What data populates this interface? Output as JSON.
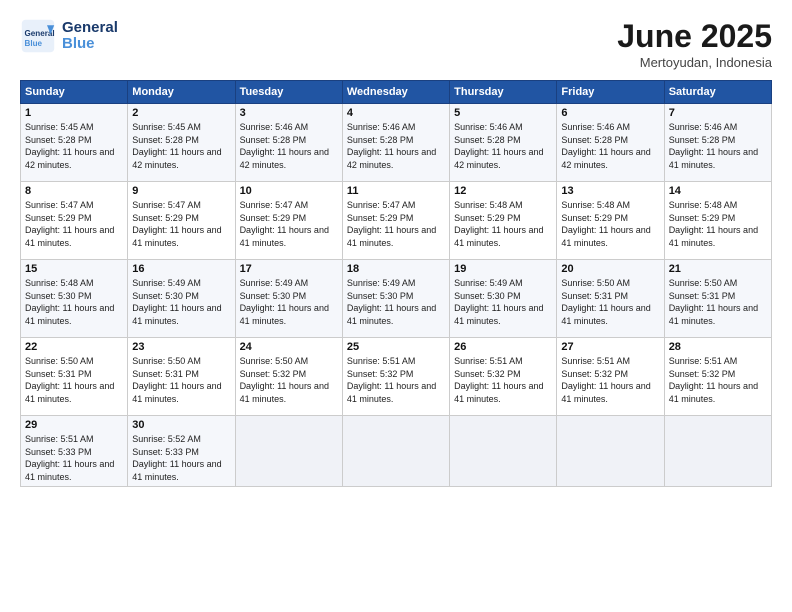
{
  "header": {
    "logo_line1": "General",
    "logo_line2": "Blue",
    "month": "June 2025",
    "location": "Mertoyudan, Indonesia"
  },
  "days_of_week": [
    "Sunday",
    "Monday",
    "Tuesday",
    "Wednesday",
    "Thursday",
    "Friday",
    "Saturday"
  ],
  "weeks": [
    [
      {
        "day": "1",
        "sunrise": "5:45 AM",
        "sunset": "5:28 PM",
        "daylight": "11 hours and 42 minutes."
      },
      {
        "day": "2",
        "sunrise": "5:45 AM",
        "sunset": "5:28 PM",
        "daylight": "11 hours and 42 minutes."
      },
      {
        "day": "3",
        "sunrise": "5:46 AM",
        "sunset": "5:28 PM",
        "daylight": "11 hours and 42 minutes."
      },
      {
        "day": "4",
        "sunrise": "5:46 AM",
        "sunset": "5:28 PM",
        "daylight": "11 hours and 42 minutes."
      },
      {
        "day": "5",
        "sunrise": "5:46 AM",
        "sunset": "5:28 PM",
        "daylight": "11 hours and 42 minutes."
      },
      {
        "day": "6",
        "sunrise": "5:46 AM",
        "sunset": "5:28 PM",
        "daylight": "11 hours and 42 minutes."
      },
      {
        "day": "7",
        "sunrise": "5:46 AM",
        "sunset": "5:28 PM",
        "daylight": "11 hours and 41 minutes."
      }
    ],
    [
      {
        "day": "8",
        "sunrise": "5:47 AM",
        "sunset": "5:29 PM",
        "daylight": "11 hours and 41 minutes."
      },
      {
        "day": "9",
        "sunrise": "5:47 AM",
        "sunset": "5:29 PM",
        "daylight": "11 hours and 41 minutes."
      },
      {
        "day": "10",
        "sunrise": "5:47 AM",
        "sunset": "5:29 PM",
        "daylight": "11 hours and 41 minutes."
      },
      {
        "day": "11",
        "sunrise": "5:47 AM",
        "sunset": "5:29 PM",
        "daylight": "11 hours and 41 minutes."
      },
      {
        "day": "12",
        "sunrise": "5:48 AM",
        "sunset": "5:29 PM",
        "daylight": "11 hours and 41 minutes."
      },
      {
        "day": "13",
        "sunrise": "5:48 AM",
        "sunset": "5:29 PM",
        "daylight": "11 hours and 41 minutes."
      },
      {
        "day": "14",
        "sunrise": "5:48 AM",
        "sunset": "5:29 PM",
        "daylight": "11 hours and 41 minutes."
      }
    ],
    [
      {
        "day": "15",
        "sunrise": "5:48 AM",
        "sunset": "5:30 PM",
        "daylight": "11 hours and 41 minutes."
      },
      {
        "day": "16",
        "sunrise": "5:49 AM",
        "sunset": "5:30 PM",
        "daylight": "11 hours and 41 minutes."
      },
      {
        "day": "17",
        "sunrise": "5:49 AM",
        "sunset": "5:30 PM",
        "daylight": "11 hours and 41 minutes."
      },
      {
        "day": "18",
        "sunrise": "5:49 AM",
        "sunset": "5:30 PM",
        "daylight": "11 hours and 41 minutes."
      },
      {
        "day": "19",
        "sunrise": "5:49 AM",
        "sunset": "5:30 PM",
        "daylight": "11 hours and 41 minutes."
      },
      {
        "day": "20",
        "sunrise": "5:50 AM",
        "sunset": "5:31 PM",
        "daylight": "11 hours and 41 minutes."
      },
      {
        "day": "21",
        "sunrise": "5:50 AM",
        "sunset": "5:31 PM",
        "daylight": "11 hours and 41 minutes."
      }
    ],
    [
      {
        "day": "22",
        "sunrise": "5:50 AM",
        "sunset": "5:31 PM",
        "daylight": "11 hours and 41 minutes."
      },
      {
        "day": "23",
        "sunrise": "5:50 AM",
        "sunset": "5:31 PM",
        "daylight": "11 hours and 41 minutes."
      },
      {
        "day": "24",
        "sunrise": "5:50 AM",
        "sunset": "5:32 PM",
        "daylight": "11 hours and 41 minutes."
      },
      {
        "day": "25",
        "sunrise": "5:51 AM",
        "sunset": "5:32 PM",
        "daylight": "11 hours and 41 minutes."
      },
      {
        "day": "26",
        "sunrise": "5:51 AM",
        "sunset": "5:32 PM",
        "daylight": "11 hours and 41 minutes."
      },
      {
        "day": "27",
        "sunrise": "5:51 AM",
        "sunset": "5:32 PM",
        "daylight": "11 hours and 41 minutes."
      },
      {
        "day": "28",
        "sunrise": "5:51 AM",
        "sunset": "5:32 PM",
        "daylight": "11 hours and 41 minutes."
      }
    ],
    [
      {
        "day": "29",
        "sunrise": "5:51 AM",
        "sunset": "5:33 PM",
        "daylight": "11 hours and 41 minutes."
      },
      {
        "day": "30",
        "sunrise": "5:52 AM",
        "sunset": "5:33 PM",
        "daylight": "11 hours and 41 minutes."
      },
      null,
      null,
      null,
      null,
      null
    ]
  ]
}
